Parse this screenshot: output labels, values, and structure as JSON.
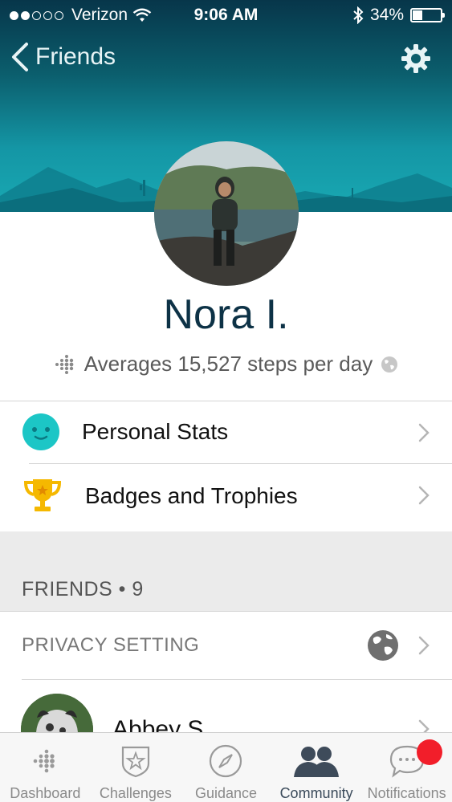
{
  "status_bar": {
    "carrier": "Verizon",
    "time": "9:06 AM",
    "battery": "34%"
  },
  "nav": {
    "back_label": "Friends"
  },
  "profile": {
    "name": "Nora I.",
    "average_steps": "Averages 15,527 steps per day"
  },
  "menu": {
    "items": [
      {
        "label": "Personal Stats",
        "icon": "smiley-face-icon"
      },
      {
        "label": "Badges and Trophies",
        "icon": "trophy-icon"
      }
    ]
  },
  "friends": {
    "header": "FRIENDS • 9",
    "privacy_label": "PRIVACY SETTING",
    "list": [
      {
        "name": "Abbey S."
      }
    ]
  },
  "tabbar": {
    "tabs": [
      {
        "label": "Dashboard",
        "icon": "dots-grid-icon"
      },
      {
        "label": "Challenges",
        "icon": "star-shield-icon"
      },
      {
        "label": "Guidance",
        "icon": "compass-icon"
      },
      {
        "label": "Community",
        "icon": "people-icon",
        "active": true
      },
      {
        "label": "Notifications",
        "icon": "chat-bubble-icon",
        "badge": true
      }
    ]
  },
  "colors": {
    "header_top": "#07364a",
    "header_bottom": "#19a9b3",
    "name_color": "#0d3246",
    "personal_stats_icon": "#1cc6c6",
    "trophy": "#f5b800",
    "notification_badge": "#f21e2a"
  }
}
